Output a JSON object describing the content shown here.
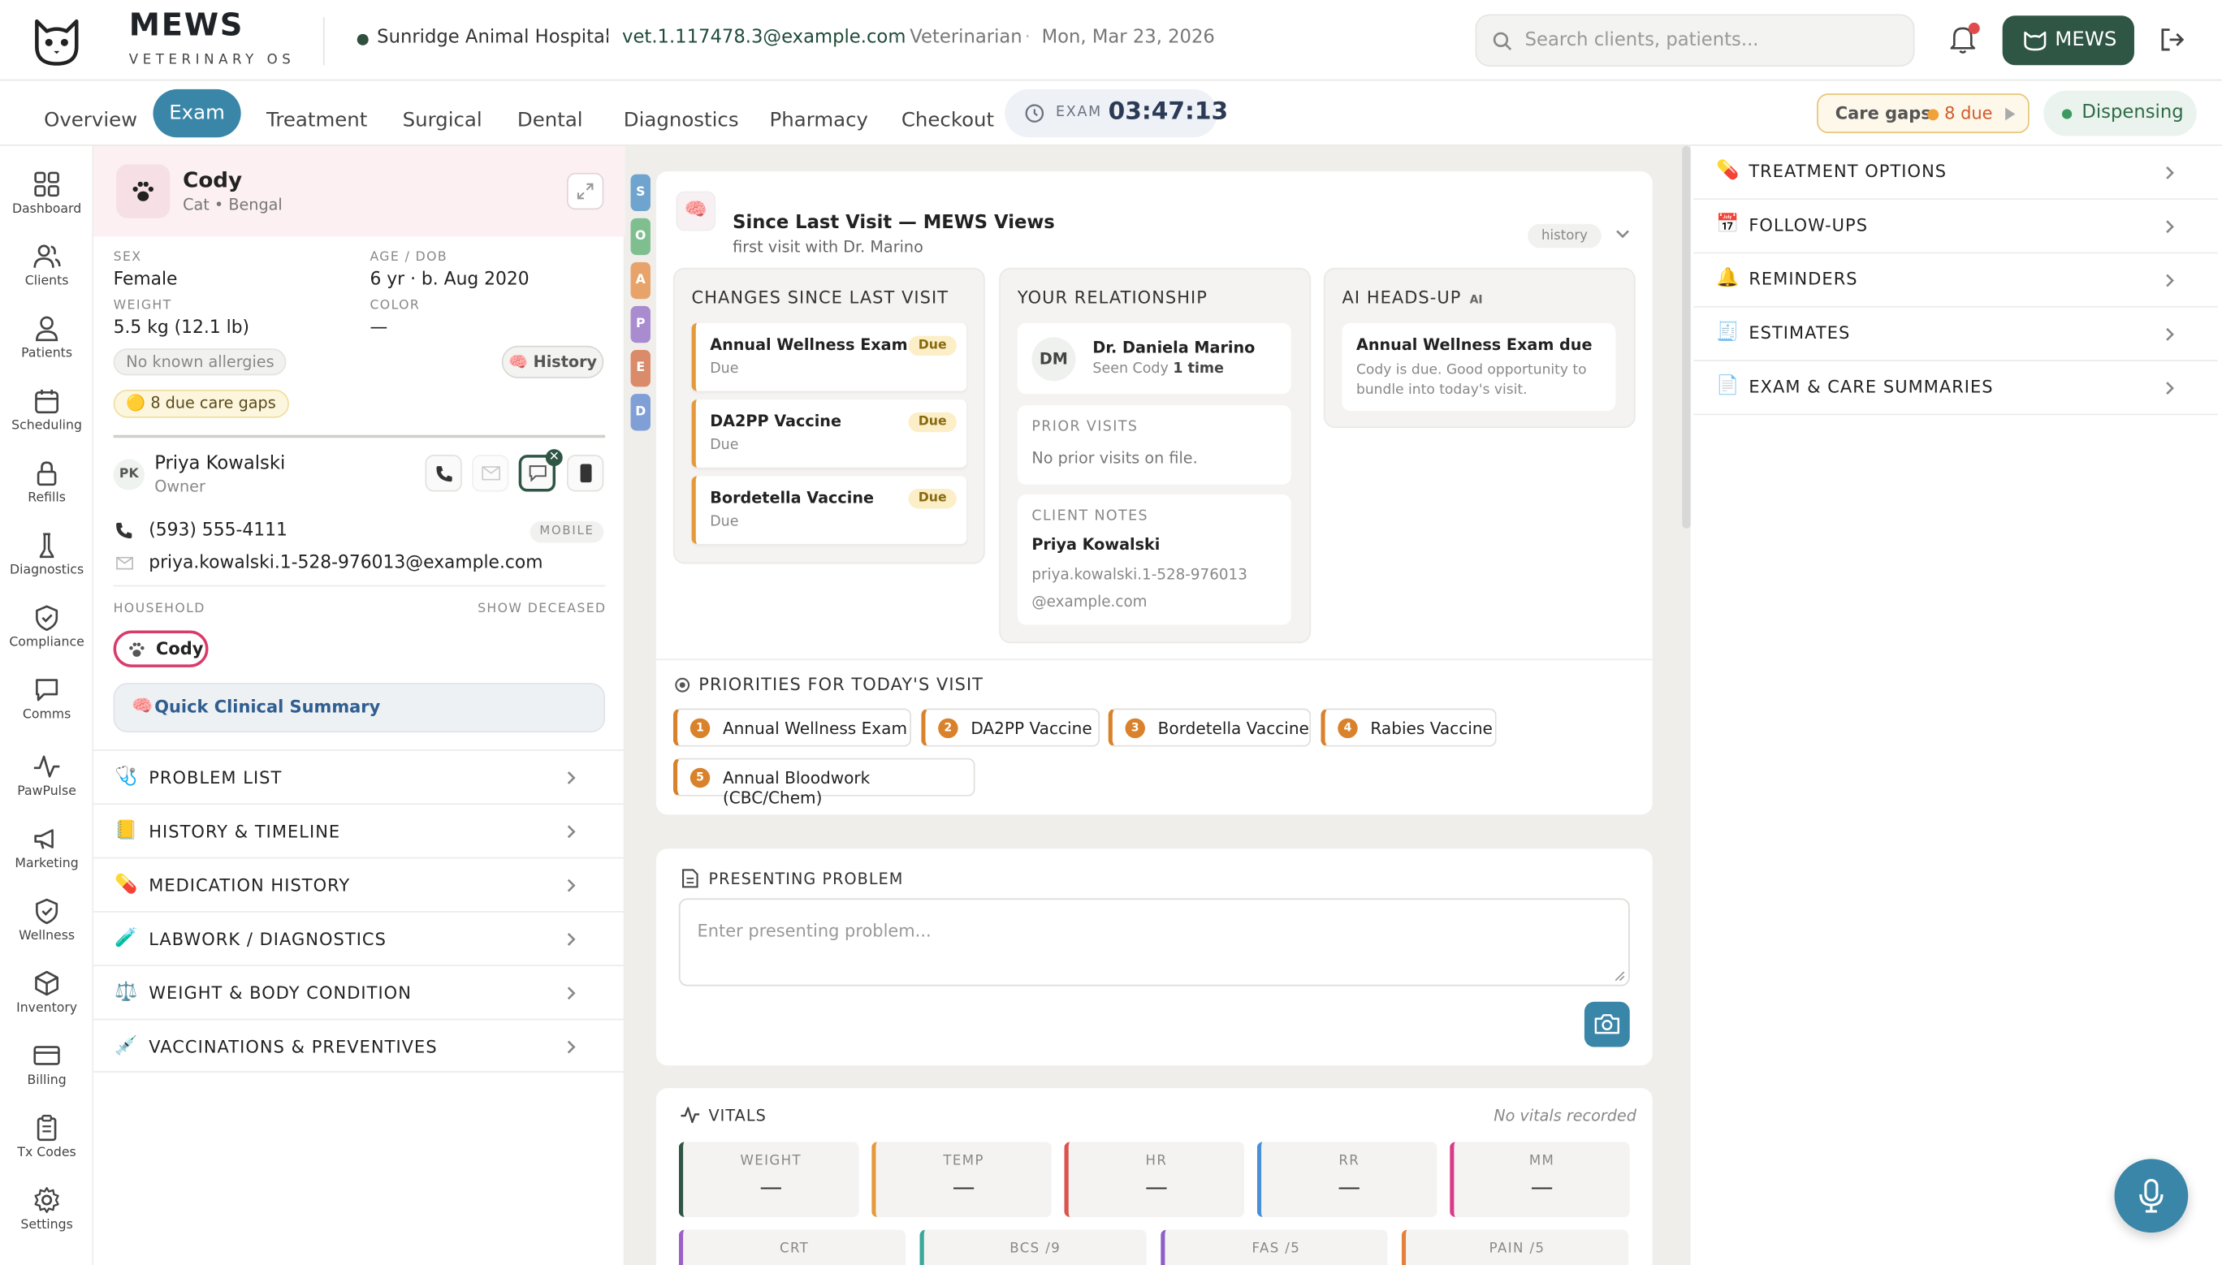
{
  "brand": {
    "name": "MEWS",
    "subtitle": "VETERINARY OS"
  },
  "header": {
    "hospital": "Sunridge Animal Hospital",
    "email": "vet.1.117478.3@example.com",
    "role": "Veterinarian",
    "date": "Mon, Mar 23, 2026",
    "separator": "·",
    "search_placeholder": "Search clients, patients...",
    "mews_button": "MEWS"
  },
  "tabs": [
    "Overview",
    "Exam",
    "Treatment",
    "Surgical",
    "Dental",
    "Diagnostics",
    "Pharmacy",
    "Checkout"
  ],
  "active_tab": "Exam",
  "timer": {
    "label": "EXAM",
    "value": "03:47:13"
  },
  "care_gaps": {
    "label": "Care gaps",
    "count": "8 due"
  },
  "dispensing": {
    "label": "Dispensing"
  },
  "leftnav": [
    {
      "label": "Dashboard",
      "icon": "dashboard-icon"
    },
    {
      "label": "Clients",
      "icon": "clients-icon"
    },
    {
      "label": "Patients",
      "icon": "patients-icon"
    },
    {
      "label": "Scheduling",
      "icon": "calendar-icon"
    },
    {
      "label": "Refills",
      "icon": "lock-icon"
    },
    {
      "label": "Diagnostics",
      "icon": "flask-icon"
    },
    {
      "label": "Compliance",
      "icon": "shield-check-icon"
    },
    {
      "label": "Comms",
      "icon": "chat-icon"
    },
    {
      "label": "PawPulse",
      "icon": "pulse-icon"
    },
    {
      "label": "Marketing",
      "icon": "megaphone-icon"
    },
    {
      "label": "Wellness",
      "icon": "shield-check-icon"
    },
    {
      "label": "Inventory",
      "icon": "box-icon"
    },
    {
      "label": "Billing",
      "icon": "card-icon"
    },
    {
      "label": "Tx Codes",
      "icon": "clipboard-icon"
    },
    {
      "label": "Settings",
      "icon": "gear-icon"
    }
  ],
  "patient": {
    "name": "Cody",
    "species": "Cat • Bengal",
    "sex_label": "SEX",
    "sex": "Female",
    "age_label": "AGE / DOB",
    "age": "6 yr · b. Aug 2020",
    "weight_label": "WEIGHT",
    "weight": "5.5 kg (12.1 lb)",
    "color_label": "COLOR",
    "color": "—",
    "allergies": "No known allergies",
    "history_button": "History",
    "care_gaps_chip": "8 due care gaps"
  },
  "owner": {
    "initials": "PK",
    "name": "Priya Kowalski",
    "role": "Owner",
    "phone": "(593) 555-4111",
    "phone_type": "MOBILE",
    "email": "priya.kowalski.1-528-976013@example.com"
  },
  "household": {
    "label": "HOUSEHOLD",
    "show_deceased": "SHOW DECEASED",
    "pets": [
      "Cody"
    ]
  },
  "quick_summary": "Quick Clinical Summary",
  "left_sections": [
    "PROBLEM LIST",
    "HISTORY & TIMELINE",
    "MEDICATION HISTORY",
    "LABWORK / DIAGNOSTICS",
    "WEIGHT & BODY CONDITION",
    "VACCINATIONS & PREVENTIVES"
  ],
  "soap": [
    "S",
    "O",
    "A",
    "P",
    "E",
    "D"
  ],
  "since_last_visit": {
    "title": "Since Last Visit — MEWS Views",
    "subtitle": "first visit with Dr. Marino",
    "tag": "history",
    "changes_title": "CHANGES SINCE LAST VISIT",
    "changes": [
      {
        "name": "Annual Wellness Exam",
        "status": "Due",
        "badge": "Due"
      },
      {
        "name": "DA2PP Vaccine",
        "status": "Due",
        "badge": "Due"
      },
      {
        "name": "Bordetella Vaccine",
        "status": "Due",
        "badge": "Due"
      }
    ],
    "relationship_title": "YOUR RELATIONSHIP",
    "doctor": {
      "initials": "DM",
      "name": "Dr. Daniela Marino",
      "seen_prefix": "Seen Cody",
      "seen_count": "1 time"
    },
    "prior_visits_label": "PRIOR VISITS",
    "prior_visits_text": "No prior visits on file.",
    "client_notes_label": "CLIENT NOTES",
    "client_notes_name": "Priya Kowalski",
    "client_notes_email": "priya.kowalski.1-528-976013@example.com",
    "ai_title": "AI HEADS-UP",
    "ai_badge": "AI",
    "ai_item_title": "Annual Wellness Exam due",
    "ai_item_text": "Cody is due. Good opportunity to bundle into today's visit."
  },
  "priorities": {
    "title": "PRIORITIES FOR TODAY'S VISIT",
    "items": [
      {
        "num": "1",
        "label": "Annual Wellness Exam"
      },
      {
        "num": "2",
        "label": "DA2PP Vaccine"
      },
      {
        "num": "3",
        "label": "Bordetella Vaccine"
      },
      {
        "num": "4",
        "label": "Rabies Vaccine"
      },
      {
        "num": "5",
        "label": "Annual Bloodwork (CBC/Chem)"
      }
    ]
  },
  "presenting_problem": {
    "title": "PRESENTING PROBLEM",
    "placeholder": "Enter presenting problem..."
  },
  "vitals": {
    "title": "VITALS",
    "status": "No vitals recorded",
    "row1": [
      {
        "label": "WEIGHT",
        "value": "—"
      },
      {
        "label": "TEMP",
        "value": "—"
      },
      {
        "label": "HR",
        "value": "—"
      },
      {
        "label": "RR",
        "value": "—"
      },
      {
        "label": "MM",
        "value": "—"
      }
    ],
    "row2": [
      {
        "label": "CRT"
      },
      {
        "label": "BCS /9"
      },
      {
        "label": "FAS /5"
      },
      {
        "label": "PAIN /5"
      }
    ]
  },
  "right_sections": [
    "TREATMENT OPTIONS",
    "FOLLOW-UPS",
    "REMINDERS",
    "ESTIMATES",
    "EXAM & CARE SUMMARIES"
  ],
  "colors": {
    "brand_green": "#2f5544",
    "accent_blue": "#3a86a8",
    "due_orange": "#d9822b",
    "highlight_pink": "#d93b6a"
  }
}
